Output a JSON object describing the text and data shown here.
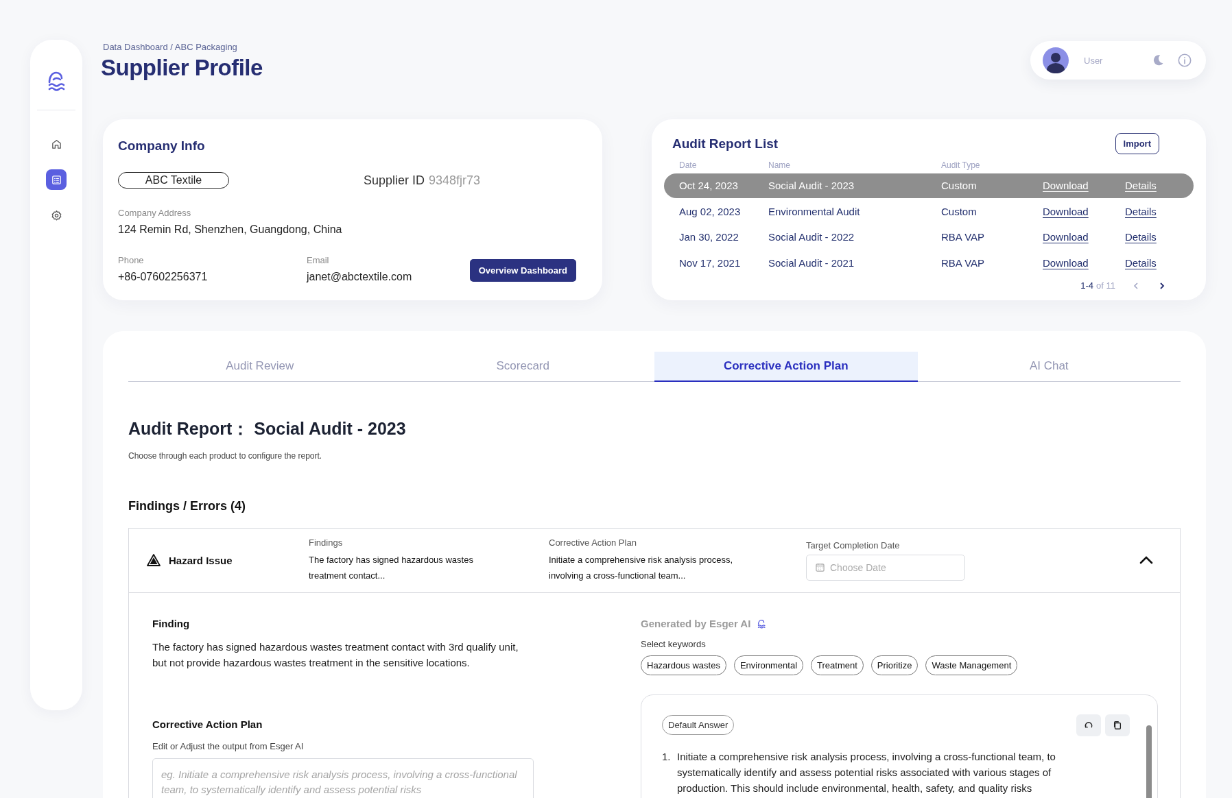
{
  "sidebar": {
    "items": [
      {
        "kind": "home",
        "selected": false
      },
      {
        "kind": "report",
        "selected": true
      },
      {
        "kind": "settings",
        "selected": false
      }
    ]
  },
  "breadcrumb": "Data Dashboard / ABC Packaging",
  "title": "Supplier Profile",
  "user": {
    "name": "User"
  },
  "company_info": {
    "title": "Company Info",
    "name": "ABC Textile",
    "supplier_id_label": "Supplier ID",
    "supplier_id": "9348fjr73",
    "address_label": "Company Address",
    "address": "124 Remin Rd, Shenzhen, Guangdong, China",
    "phone_label": "Phone",
    "phone": "+86-07602256371",
    "email_label": "Email",
    "email": "janet@abctextile.com",
    "button": "Overview Dashboard"
  },
  "audit_reports": {
    "title": "Audit Report List",
    "import_button": "Import",
    "columns": [
      "Date",
      "Name",
      "Audit Type"
    ],
    "rows": [
      {
        "date": "Oct 24, 2023",
        "name": "Social Audit - 2023",
        "type": "Custom",
        "download": "Download",
        "details": "Details",
        "selected": true
      },
      {
        "date": "Aug 02, 2023",
        "name": "Environmental Audit",
        "type": "Custom",
        "download": "Download",
        "details": "Details",
        "selected": false
      },
      {
        "date": "Jan 30, 2022",
        "name": "Social Audit - 2022",
        "type": "RBA VAP",
        "download": "Download",
        "details": "Details",
        "selected": false
      },
      {
        "date": "Nov 17, 2021",
        "name": "Social Audit - 2021",
        "type": "RBA VAP",
        "download": "Download",
        "details": "Details",
        "selected": false
      }
    ],
    "pagination": {
      "range": "1-4",
      "total": "of 11"
    }
  },
  "tabs": [
    {
      "label": "Audit Review",
      "selected": false
    },
    {
      "label": "Scorecard",
      "selected": false
    },
    {
      "label": "Corrective Action Plan",
      "selected": true
    },
    {
      "label": "AI Chat",
      "selected": false
    }
  ],
  "report": {
    "heading": "Audit Report： Social Audit - 2023",
    "subtitle": "Choose through each product to configure the report."
  },
  "findings": {
    "title": "Findings / Errors (4)",
    "items": [
      {
        "category": "Hazard Issue",
        "findings_label": "Findings",
        "findings": "The factory has signed hazardous wastes treatment contact...",
        "cap_label": "Corrective Action Plan",
        "cap": "Initiate a comprehensive risk analysis process, involving a cross-functional team...",
        "date_label": "Target Completion Date",
        "date_placeholder": "Choose Date",
        "expanded": true
      }
    ]
  },
  "detail": {
    "finding_title": "Finding",
    "finding_text": "The factory has signed hazardous wastes treatment contact with 3rd qualify unit, but not provide hazardous wastes treatment in the sensitive locations.",
    "cap_title": "Corrective Action Plan",
    "cap_hint": "Edit or Adjust the output from Esger AI",
    "cap_placeholder": "eg. Initiate a comprehensive risk analysis process, involving a cross-functional team, to systematically identify and assess potential risks",
    "generated_label": "Generated by Esger AI",
    "keywords_label": "Select keywords",
    "keywords": [
      "Hazardous wastes",
      "Environmental",
      "Treatment",
      "Prioritize",
      "Waste Management"
    ],
    "answer_tag": "Default Answer",
    "answers": [
      {
        "marker": "1.",
        "text": "Initiate a comprehensive risk analysis process, involving a cross-functional team, to systematically identify and assess potential risks associated with various stages of production. This should include environmental, health, safety, and quality risks"
      }
    ]
  }
}
